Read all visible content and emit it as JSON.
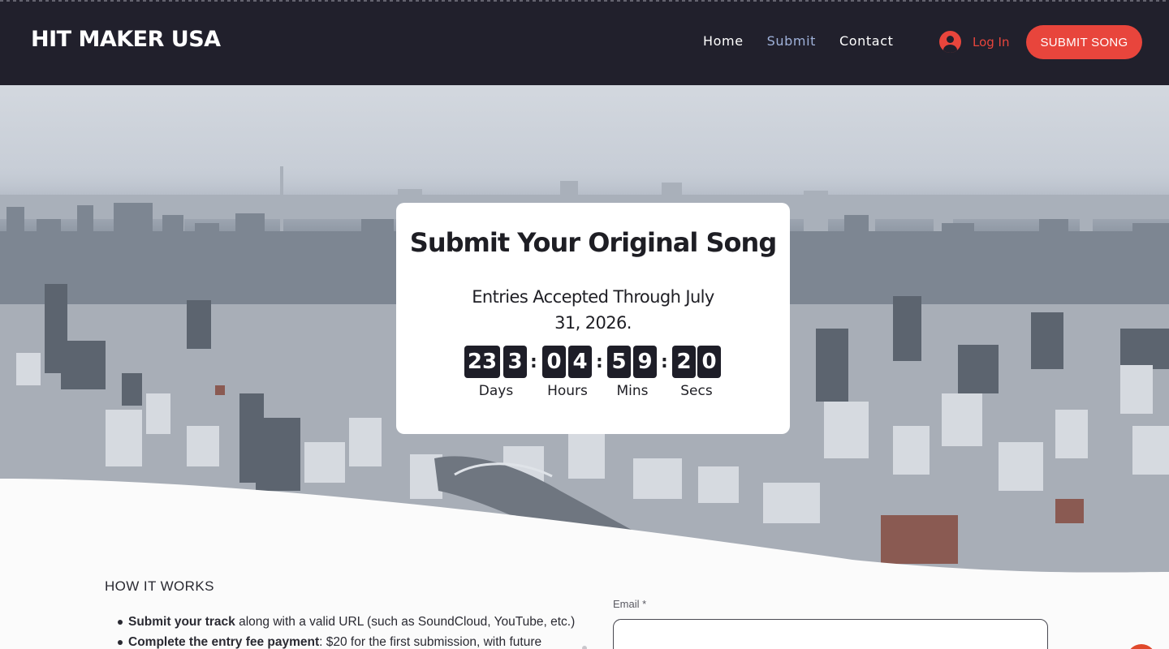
{
  "header": {
    "logo": "HIT MAKER USA",
    "nav": [
      {
        "label": "Home",
        "active": false
      },
      {
        "label": "Submit",
        "active": true
      },
      {
        "label": "Contact",
        "active": false
      }
    ],
    "login_label": "Log In",
    "login_icon": "user-avatar-icon",
    "submit_button": "SUBMIT SONG"
  },
  "colors": {
    "header_bg": "#21202c",
    "accent": "#e8453c",
    "nav_active": "#9fb1d9",
    "card_bg": "#ffffff",
    "digit_bg": "#1e1e28"
  },
  "hero": {
    "title": "Submit Your Original Song",
    "subtitle_line1": "Entries Accepted Through July",
    "subtitle_line2": "31, 2026.",
    "countdown": {
      "days": {
        "d1": "23",
        "d2": "3",
        "label": "Days"
      },
      "hours": {
        "d1": "0",
        "d2": "4",
        "label": "Hours"
      },
      "mins": {
        "d1": "5",
        "d2": "9",
        "label": "Mins"
      },
      "secs": {
        "d1": "2",
        "d2": "0",
        "label": "Secs"
      },
      "separator": ":"
    }
  },
  "content": {
    "how_title": "HOW IT WORKS",
    "items": [
      {
        "bold": "Submit your track",
        "text": " along with a valid URL (such as SoundCloud, YouTube, etc.)"
      },
      {
        "bold": "Complete the entry fee payment",
        "text": ": $20 for the first submission, with future"
      }
    ]
  },
  "form": {
    "email_label": "Email *"
  }
}
